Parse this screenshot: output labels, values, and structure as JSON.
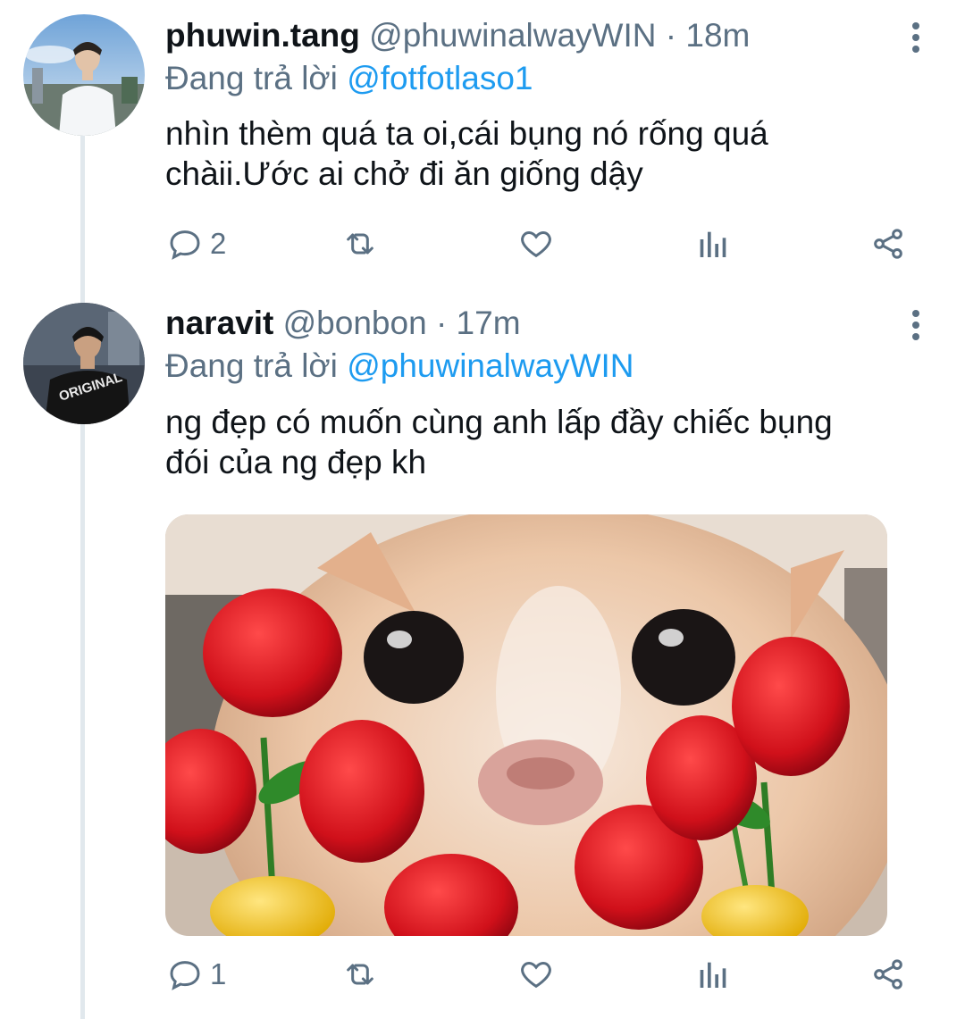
{
  "tweets": [
    {
      "name": "phuwin.tang",
      "handle": "@phuwinalwayWIN",
      "time": "18m",
      "reply_prefix": "Đang trả lời",
      "reply_to": "@fotfotlaso1",
      "text_lines": [
        "nhìn thèm quá ta oi,cái bụng nó rống quá",
        "chàii.Ước ai chở đi ăn giống dậy"
      ],
      "reply_count": "2"
    },
    {
      "name": "naravit",
      "handle": "@bonbon",
      "time": "17m",
      "reply_prefix": "Đang trả lời",
      "reply_to": "@phuwinalwayWIN",
      "text_lines": [
        "ng đẹp có muốn cùng anh lấp đầy chiếc bụng",
        "đói của ng đẹp kh"
      ],
      "reply_count": "1",
      "shirt_text": "ORIGINAL"
    }
  ],
  "separator": "·",
  "icons": [
    "more-vertical-icon",
    "reply-icon",
    "retweet-icon",
    "like-icon",
    "analytics-icon",
    "share-icon"
  ],
  "colors": {
    "link": "#1d9bf0",
    "muted": "#5b7083",
    "text": "#0f1419",
    "thread": "#e1e8ed"
  }
}
